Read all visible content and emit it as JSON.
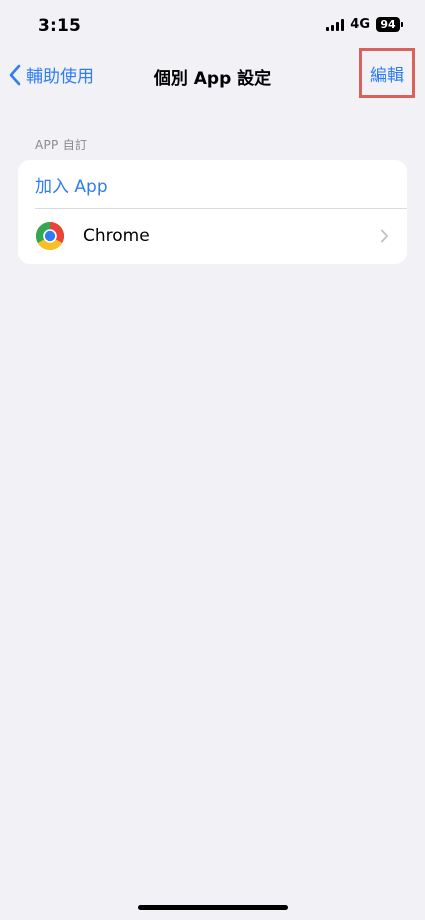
{
  "status_bar": {
    "time": "3:15",
    "network": "4G",
    "battery": "94",
    "signal_icon": "cellular-signal-icon",
    "battery_icon": "battery-icon"
  },
  "nav": {
    "back_label": "輔助使用",
    "back_icon": "chevron-left-icon",
    "title": "個別 App 設定",
    "edit_label": "編輯"
  },
  "section": {
    "header": "APP 自訂",
    "add_label": "加入 App",
    "apps": [
      {
        "name": "Chrome",
        "icon": "chrome-icon"
      }
    ]
  },
  "colors": {
    "accent": "#2f7cf6",
    "background": "#f2f1f6",
    "highlight_border": "#d9625a"
  }
}
